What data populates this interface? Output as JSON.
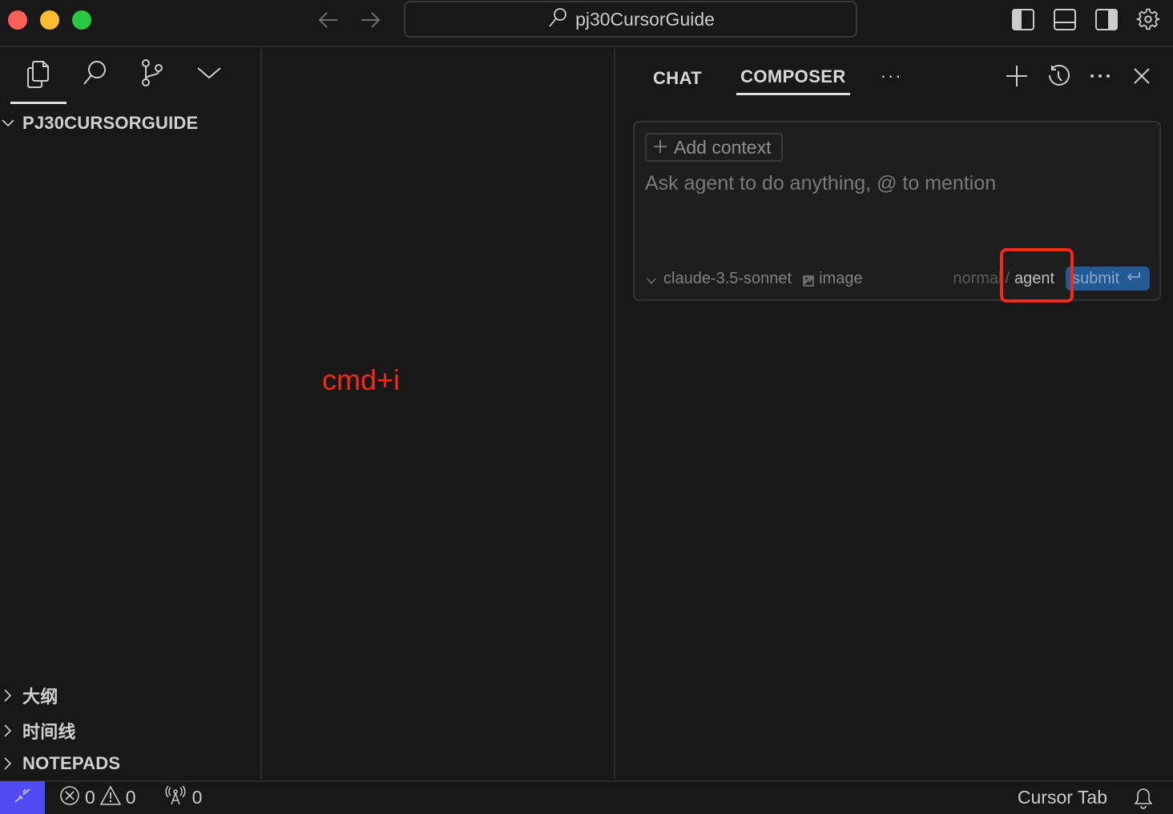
{
  "titlebar": {
    "search_label": "pj30CursorGuide",
    "icons": [
      "arrow-left-icon",
      "arrow-right-icon",
      "search-icon",
      "toggle-primary-sidebar-icon",
      "toggle-panel-icon",
      "toggle-secondary-sidebar-icon",
      "gear-icon"
    ]
  },
  "sidebar": {
    "activity_tabs": [
      {
        "name": "explorer",
        "icon": "files-icon",
        "active": true
      },
      {
        "name": "search",
        "icon": "search-icon",
        "active": false
      },
      {
        "name": "source-control",
        "icon": "source-control-icon",
        "active": false
      },
      {
        "name": "more",
        "icon": "chevron-down-icon",
        "active": false
      }
    ],
    "project_title": "PJ30CURSORGUIDE",
    "sections": [
      {
        "label": "大纲"
      },
      {
        "label": "时间线"
      },
      {
        "label": "NOTEPADS"
      }
    ]
  },
  "editor": {
    "hint": "cmd+i",
    "hint_color": "#f5291b"
  },
  "panel": {
    "tabs": [
      {
        "label": "CHAT",
        "active": false
      },
      {
        "label": "COMPOSER",
        "active": true
      }
    ],
    "more_label": "···",
    "composer": {
      "add_context_label": "Add context",
      "input_value": "",
      "input_placeholder": "Ask agent to do anything, @ to mention",
      "model": "claude-3.5-sonnet",
      "image_label": "image",
      "mode_normal": "normal",
      "mode_separator": "/",
      "mode_agent": "agent",
      "submit_label": "submit"
    }
  },
  "statusbar": {
    "errors": "0",
    "warnings": "0",
    "ports": "0",
    "cursor_tab": "Cursor Tab"
  },
  "colors": {
    "accent_remote": "#4f4bf0",
    "submit_bg": "#215a94",
    "highlight_red": "#f5291b"
  }
}
